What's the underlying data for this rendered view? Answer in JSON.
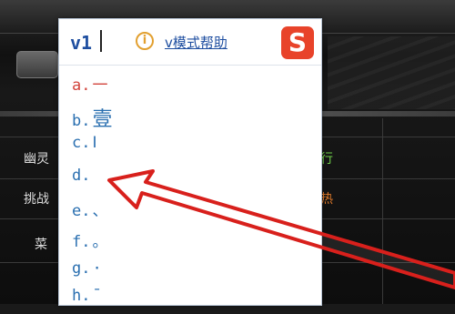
{
  "background": {
    "rows": [
      {
        "left": "幽灵",
        "right": "行",
        "right_color": "green"
      },
      {
        "left": "挑战",
        "right": "热",
        "right_color": "orange"
      },
      {
        "left": "菜",
        "right": "",
        "right_color": "green"
      }
    ]
  },
  "ime": {
    "input_text": "v1",
    "help_label": "v模式帮助",
    "logo_letter": "S",
    "candidates": [
      {
        "key": "a.",
        "value": "一"
      },
      {
        "key": "b.",
        "value": "壹"
      },
      {
        "key": "c.",
        "value": "Ⅰ"
      },
      {
        "key": "d.",
        "value": ""
      },
      {
        "key": "e.",
        "value": "、"
      },
      {
        "key": "f.",
        "value": "。"
      },
      {
        "key": "g.",
        "value": "·"
      },
      {
        "key": "h.",
        "value": "¯"
      }
    ]
  },
  "colors": {
    "arrow": "#d8201c",
    "highlight": "#d2443c",
    "candidate": "#2a6fb0"
  }
}
